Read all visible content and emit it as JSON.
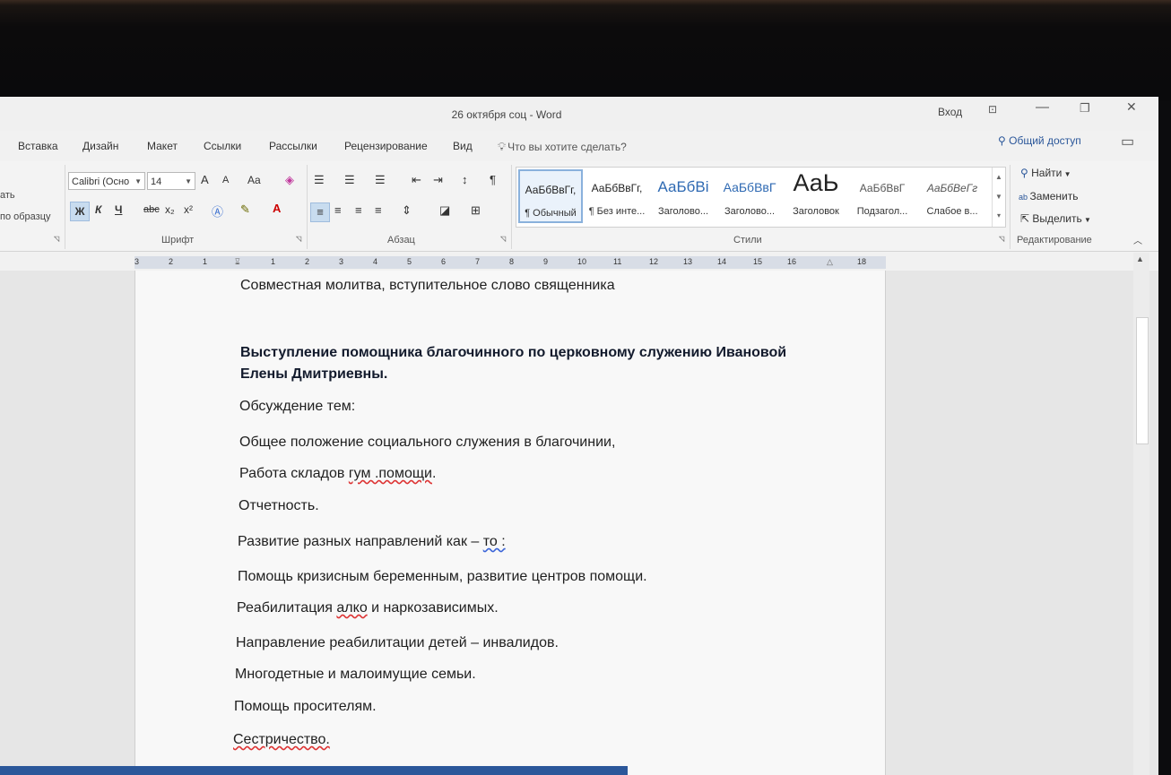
{
  "window": {
    "title": "26 октября соц - Word",
    "signin": "Вход",
    "share": "Общий доступ",
    "controls": {
      "ribbon_options": "⊡",
      "minimize": "—",
      "restore": "❐",
      "close": "✕"
    }
  },
  "menu": {
    "tabs": [
      "Вставка",
      "Дизайн",
      "Макет",
      "Ссылки",
      "Рассылки",
      "Рецензирование",
      "Вид"
    ],
    "tell_me": "Что вы хотите сделать?"
  },
  "ribbon": {
    "clipboard": {
      "paste_fragment": "ать",
      "format_painter_fragment": "по образцу"
    },
    "font": {
      "label": "Шрифт",
      "font_name": "Calibri (Осно",
      "font_size": "14",
      "grow": "A",
      "shrink": "A",
      "case": "Aa",
      "bold": "Ж",
      "italic": "К",
      "underline": "Ч",
      "strike": "abc",
      "subscript": "x₂",
      "superscript": "x²"
    },
    "paragraph": {
      "label": "Абзац",
      "pilcrow": "¶"
    },
    "styles": {
      "label": "Стили",
      "items": [
        {
          "sample": "АаБбВвГг,",
          "name": "¶ Обычный",
          "selected": true
        },
        {
          "sample": "АаБбВвГг,",
          "name": "¶ Без инте..."
        },
        {
          "sample": "АаБбВі",
          "name": "Заголово..."
        },
        {
          "sample": "АаБбВвГ",
          "name": "Заголово..."
        },
        {
          "sample": "АаЬ",
          "name": "Заголовок"
        },
        {
          "sample": "АаБбВвГ",
          "name": "Подзагол..."
        },
        {
          "sample": "АаБбВеГг",
          "name": "Слабое в..."
        }
      ]
    },
    "editing": {
      "label": "Редактирование",
      "find": "Найти",
      "replace": "Заменить",
      "select": "Выделить"
    }
  },
  "ruler": {
    "ticks": [
      "3",
      "2",
      "1",
      "1",
      "2",
      "3",
      "4",
      "5",
      "6",
      "7",
      "8",
      "9",
      "10",
      "11",
      "12",
      "13",
      "14",
      "15",
      "16",
      "18"
    ]
  },
  "document": {
    "line1": "Совместная молитва, вступительное слово священника",
    "bold1": "Выступление помощника благочинного по церковному служению Ивановой",
    "bold2": "Елены Дмитриевны.",
    "line2": "Обсуждение тем:",
    "line3": "Общее положение социального служения в благочинии,",
    "line4_a": "Работа складов ",
    "line4_b": "гум .помощи",
    "line4_c": ".",
    "line5": "Отчетность.",
    "line6_a": "Развитие разных направлений как – ",
    "line6_b": "то :",
    "line7": "Помощь кризисным беременным, развитие центров помощи.",
    "line8_a": "Реабилитация ",
    "line8_b": "алко",
    "line8_c": " и наркозависимых.",
    "line9": "Направление реабилитации детей – инвалидов.",
    "line10": "Многодетные и малоимущие семьи.",
    "line11": "Помощь просителям.",
    "line12": "Сестричество."
  },
  "colors": {
    "accent": "#2b579a",
    "selection": "#c8dcef"
  }
}
